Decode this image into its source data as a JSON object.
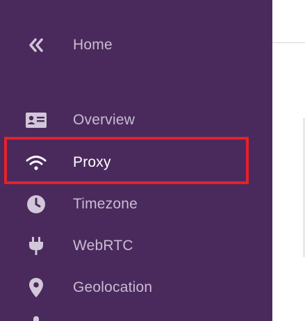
{
  "sidebar": {
    "items": [
      {
        "label": "Home",
        "icon": "double-chevron-left-icon"
      },
      {
        "label": "Overview",
        "icon": "id-card-icon"
      },
      {
        "label": "Proxy",
        "icon": "wifi-icon",
        "active": true
      },
      {
        "label": "Timezone",
        "icon": "clock-icon"
      },
      {
        "label": "WebRTC",
        "icon": "plug-icon"
      },
      {
        "label": "Geolocation",
        "icon": "location-pin-icon"
      }
    ]
  },
  "colors": {
    "sidebar_bg": "#4a2a5c",
    "highlight_border": "#e8202a",
    "label_color": "#c9bcd3",
    "active_label_color": "#ffffff"
  }
}
